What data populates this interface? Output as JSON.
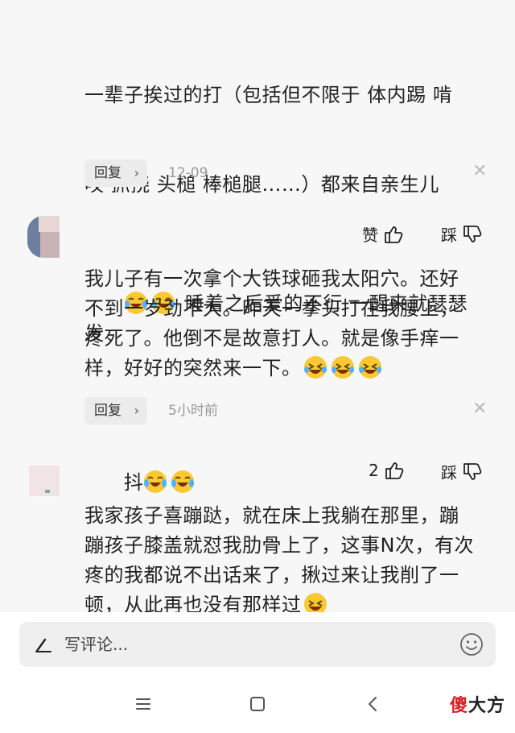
{
  "comments": [
    {
      "text_lines": [
        "一辈子挨过的打（包括但不限于 体内踢 啃",
        "咬 抓挠 头槌 棒槌腿……）都来自亲生儿"
      ],
      "line3_text": " 睡着之后爱的不行 一醒来就瑟瑟发",
      "line4_text": "抖",
      "reply_label": "回复",
      "time": "12-09"
    },
    {
      "like_label": "赞",
      "dislike_label": "踩",
      "text": "我儿子有一次拿个大铁球砸我太阳穴。还好\n不到一岁劲不大。昨天一拳头打在我腰上，\n疼死了。他倒不是故意打人。就是像手痒一\n样，好好的突然来一下。",
      "reply_label": "回复",
      "time": "5小时前"
    },
    {
      "like_count": "2",
      "dislike_label": "踩",
      "text": "我家孩子喜蹦跶，就在床上我躺在那里，蹦\n蹦孩子膝盖就怼我肋骨上了，这事N次，有次\n疼的我都说不出话来了，揪过来让我削了一\n顿，从此再也没有那样过"
    }
  ],
  "input_bar": {
    "placeholder": "写评论..."
  },
  "watermark": {
    "first_char": "傻",
    "rest": "大方"
  },
  "icons": {
    "emoji_tears": "laughing-crying-face-icon",
    "emoji_laugh": "grinning-sweat-face-icon",
    "thumb_up": "thumb-up-icon",
    "thumb_down": "thumb-down-icon",
    "close": "close-icon",
    "pen": "pen-icon",
    "smile": "smile-icon"
  }
}
